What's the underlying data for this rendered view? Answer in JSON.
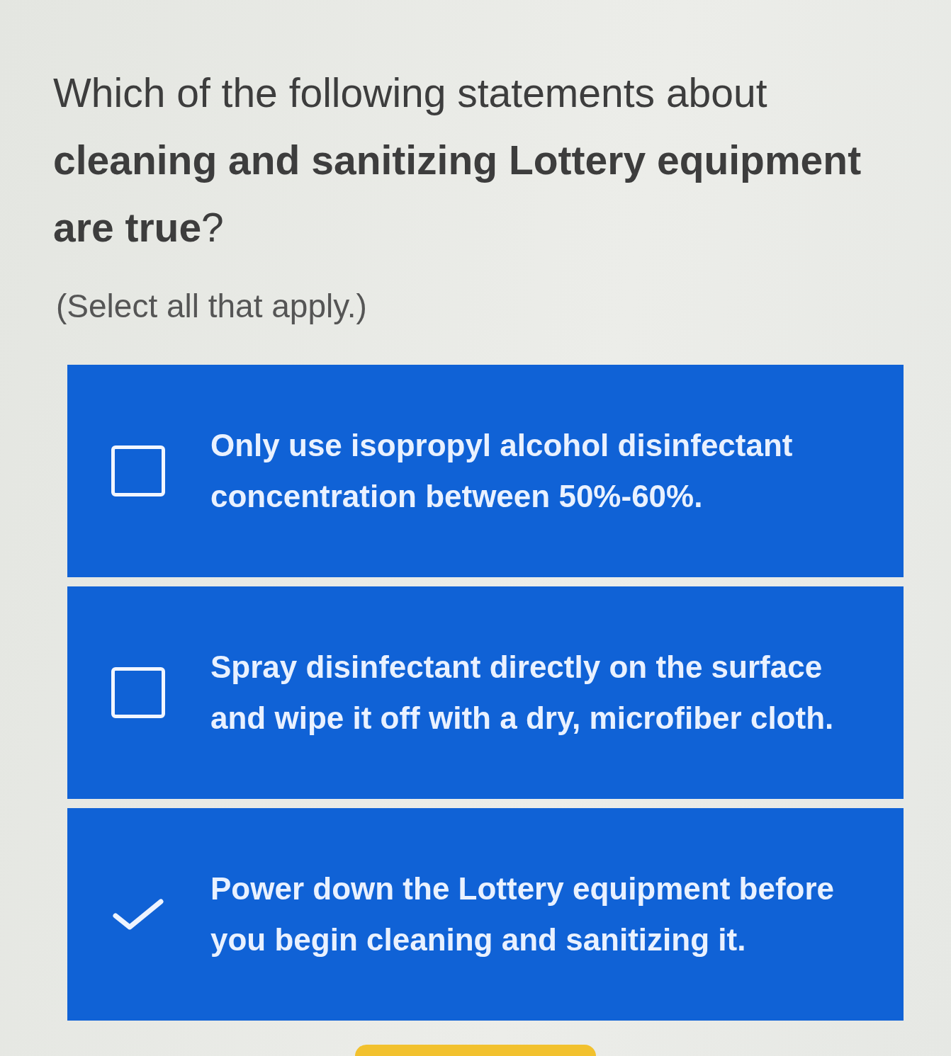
{
  "question": "Which of the following statements about **cleaning and sanitizing Lottery equipment are true**?",
  "hint": "(Select all that apply.)",
  "options": [
    {
      "text": "Only use isopropyl alcohol disinfectant concentration between 50%-60%.",
      "checked": false
    },
    {
      "text": "Spray disinfectant directly on the surface and wipe it off with a dry, microfiber cloth.",
      "checked": false
    },
    {
      "text": "Power down the Lottery equipment before you begin cleaning and sanitizing it.",
      "checked": true
    }
  ]
}
